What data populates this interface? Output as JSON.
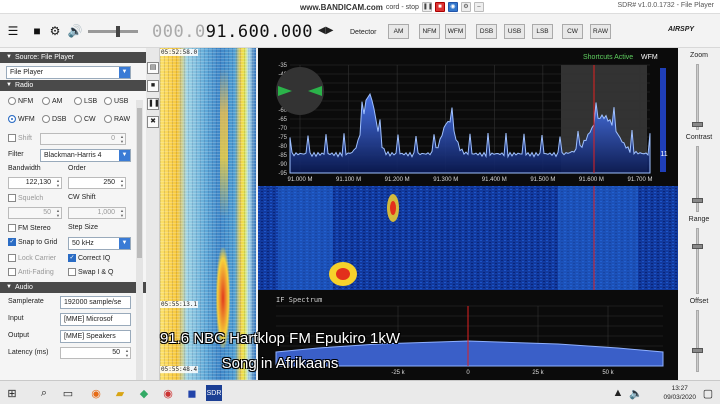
{
  "titlebar": {
    "bandicam_url": "www.BANDICAM.com",
    "bandicam_status": "cord - stop",
    "window_title": "SDR# v1.0.0.1732 - File Player"
  },
  "toolbar": {
    "frequency_dim": "000.0",
    "frequency_main": "91.600.000",
    "detector_label": "Detector",
    "modes": [
      "AM",
      "NFM",
      "WFM",
      "DSB",
      "USB",
      "LSB",
      "CW",
      "RAW"
    ],
    "brand": "AIRSPY"
  },
  "left_panel": {
    "source_header": "Source: File Player",
    "source_value": "File Player",
    "radio_header": "Radio",
    "modes_row1": [
      "NFM",
      "AM",
      "LSB",
      "USB"
    ],
    "modes_row2": [
      "WFM",
      "DSB",
      "CW",
      "RAW"
    ],
    "selected_mode": "WFM",
    "shift_label": "Shift",
    "shift_value": "0",
    "filter_label": "Filter",
    "filter_value": "Blackman-Harris 4",
    "bandwidth_label": "Bandwidth",
    "bandwidth_value": "122,130",
    "order_label": "Order",
    "order_value": "250",
    "squelch_label": "Squelch",
    "squelch_value": "50",
    "cwshift_label": "CW Shift",
    "cwshift_value": "1,000",
    "fmstereo_label": "FM Stereo",
    "stepsize_label": "Step Size",
    "snap_label": "Snap to Grid",
    "step_value": "50 kHz",
    "lockcarrier_label": "Lock Carrier",
    "correctiq_label": "Correct IQ",
    "antifading_label": "Anti-Fading",
    "swapiq_label": "Swap I & Q",
    "audio_header": "Audio",
    "samplerate_label": "Samplerate",
    "samplerate_value": "192000 sample/se",
    "input_label": "Input",
    "input_value": "[MME] Microsof",
    "output_label": "Output",
    "output_value": "[MME] Speakers",
    "latency_label": "Latency (ms)",
    "latency_value": "50"
  },
  "waterfall_left": {
    "times": [
      "05:52:58.0",
      "05:55:13.1",
      "05:55:48.4"
    ]
  },
  "spectrum": {
    "shortcuts": "Shortcuts Active",
    "mode_tag": "WFM",
    "db_ticks": [
      "-35",
      "-40",
      "-45",
      "-50",
      "-55",
      "-60",
      "-65",
      "-70",
      "-75",
      "-80",
      "-85",
      "-90",
      "-95"
    ],
    "freq_ticks": [
      "91.000 M",
      "91.100 M",
      "91.200 M",
      "91.300 M",
      "91.400 M",
      "91.500 M",
      "91.600 M",
      "91.700 M"
    ],
    "snr": "11",
    "peak_positions": [
      0.22,
      0.44,
      0.87
    ]
  },
  "if_spectrum": {
    "label": "IF Spectrum",
    "freq_ticks": [
      "-25 k",
      "0",
      "25 k",
      "50 k"
    ]
  },
  "right_bar": {
    "labels": [
      "Zoom",
      "Contrast",
      "Range",
      "Offset"
    ]
  },
  "overlay": {
    "line1": "91.6 NBC Hartklop FM  Epukiro 1kW",
    "line2": "Song in Afrikaans"
  },
  "taskbar": {
    "time": "13:27",
    "date": "09/03/2020"
  },
  "colors": {
    "accent": "#2b6cc4",
    "spectrum_line": "#6fa0ff",
    "tuner_line": "#e02020",
    "waterfall_bg": "#0b2a8c"
  }
}
